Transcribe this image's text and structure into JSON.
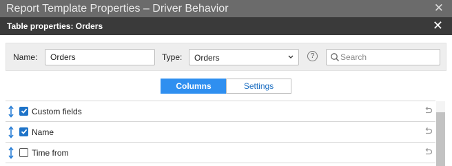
{
  "outer_window": {
    "title": "Report Template Properties – Driver Behavior",
    "close_glyph": "✕"
  },
  "dialog": {
    "title": "Table properties: Orders",
    "close_glyph": "✕"
  },
  "form": {
    "name_label": "Name:",
    "name_value": "Orders",
    "type_label": "Type:",
    "type_value": "Orders",
    "help_glyph": "?",
    "search_placeholder": "Search"
  },
  "tabs": {
    "columns": "Columns",
    "settings": "Settings",
    "active": "columns"
  },
  "columns": [
    {
      "label": "Custom fields",
      "checked": true
    },
    {
      "label": "Name",
      "checked": true
    },
    {
      "label": "Time from",
      "checked": false
    }
  ],
  "colors": {
    "accent": "#2f8ff0",
    "checkbox_on": "#1e73c8",
    "outer_titlebar": "#6b6b6b",
    "dialog_titlebar": "#3a3a3a",
    "drag_handle": "#2a7fd6"
  },
  "icons": {
    "outer_close": "close-icon",
    "dialog_close": "close-icon",
    "select_arrow": "chevron-down-icon",
    "help": "help-icon",
    "search": "search-icon",
    "drag": "drag-handle-icon",
    "reset": "undo-icon"
  }
}
